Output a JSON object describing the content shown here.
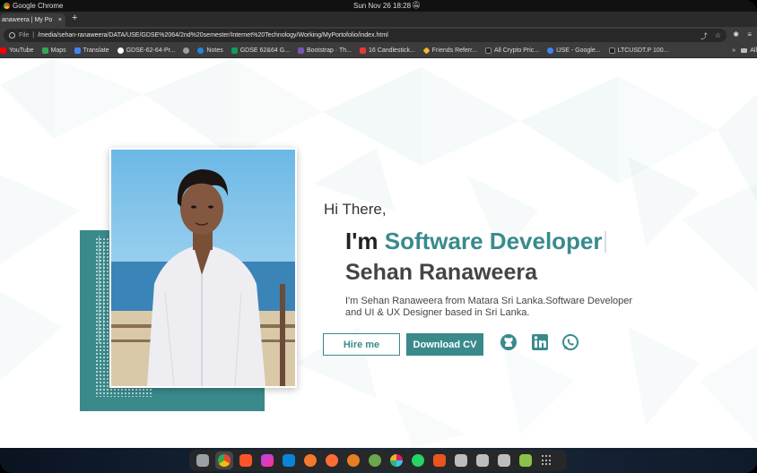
{
  "topbar": {
    "app_name": "Google Chrome",
    "clock": "Sun Nov 26  18:28"
  },
  "tab": {
    "title": "anaweera | My Po",
    "close": "×",
    "new_tab": "+"
  },
  "omnibox": {
    "scheme_label": "File",
    "url": "/media/sehan-ranaweera/DATA/USE/GDSE%2064/2nd%20semester/Internet%20Technology/Working/MyPortofolio/index.html"
  },
  "bookmarks": {
    "items": [
      {
        "label": "YouTube",
        "color": "#ff0000"
      },
      {
        "label": "Maps",
        "color": "#34a853"
      },
      {
        "label": "Translate",
        "color": "#4285f4"
      },
      {
        "label": "GDSE-62-64-Pr...",
        "color": "#ffffff"
      },
      {
        "label": "",
        "color": "#9e9e9e"
      },
      {
        "label": "Notes",
        "color": "#1e88e5"
      },
      {
        "label": "GDSE 62&64 G...",
        "color": "#0f9d58"
      },
      {
        "label": "Bootstrap · Th...",
        "color": "#7952b3"
      },
      {
        "label": "16 Candlestick...",
        "color": "#e53935"
      },
      {
        "label": "Friends Referr...",
        "color": "#f3ba2f"
      },
      {
        "label": "All Crypto Pric...",
        "color": "#222222"
      },
      {
        "label": "IJSE - Google...",
        "color": "#4285f4"
      },
      {
        "label": "LTCUSDT.P 100...",
        "color": "#222222"
      }
    ],
    "more": "»",
    "all_label": "All"
  },
  "hero": {
    "greeting": "Hi There,",
    "prefix": "I'm",
    "role": "Software Developer",
    "name": "Sehan Ranaweera",
    "description": "I'm Sehan Ranaweera from Matara Sri Lanka.Software Developer and UI & UX Designer based in Sri Lanka.",
    "hire_button": "Hire me",
    "cv_button": "Download CV",
    "accent_color": "#3a8a8c"
  },
  "dock": {
    "apps": [
      {
        "name": "files",
        "color": "#9aa0a6"
      },
      {
        "name": "chrome",
        "color": "#fbbc05",
        "active": true
      },
      {
        "name": "brave",
        "color": "#fb542b"
      },
      {
        "name": "phpstorm",
        "color": "#b345f1"
      },
      {
        "name": "vscode",
        "color": "#0a84d6"
      },
      {
        "name": "blender",
        "color": "#f5792a"
      },
      {
        "name": "postman",
        "color": "#ff6c37"
      },
      {
        "name": "app-orange",
        "color": "#e67e22"
      },
      {
        "name": "app-gnome",
        "color": "#6aa84f"
      },
      {
        "name": "slack",
        "color": "#e01e5a"
      },
      {
        "name": "whatsapp",
        "color": "#25d366"
      },
      {
        "name": "software",
        "color": "#e95420"
      },
      {
        "name": "window-1",
        "color": "#bdbdbd"
      },
      {
        "name": "window-2",
        "color": "#bdbdbd"
      },
      {
        "name": "window-3",
        "color": "#bdbdbd"
      },
      {
        "name": "trash",
        "color": "#8bc34a"
      }
    ]
  }
}
